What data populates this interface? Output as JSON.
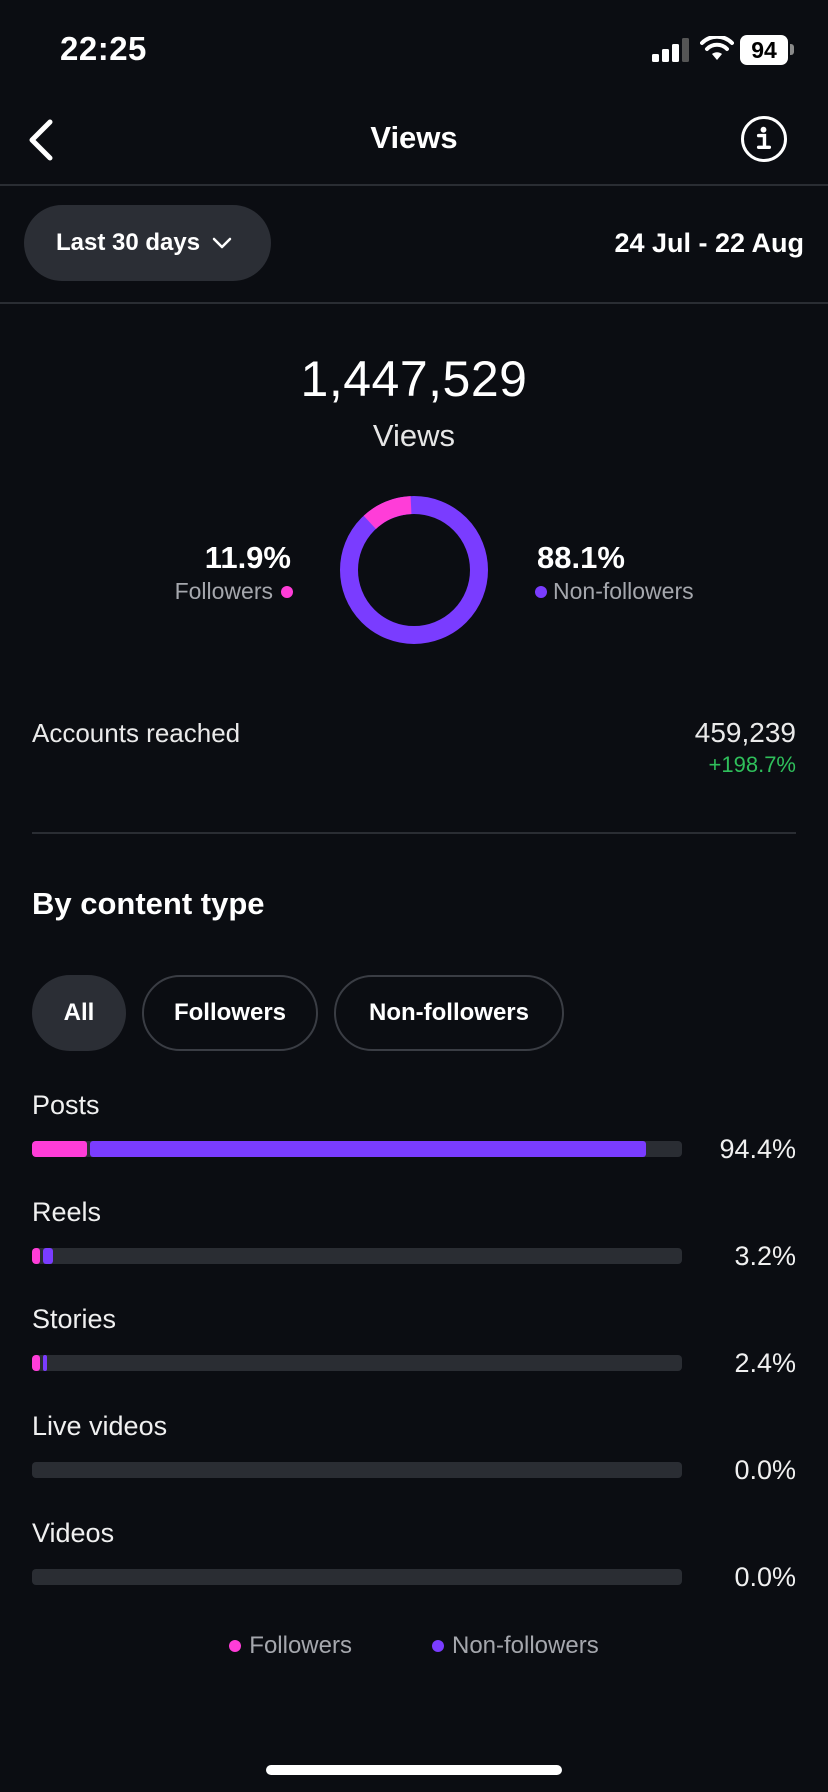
{
  "status_bar": {
    "time": "22:25",
    "battery": "94"
  },
  "header": {
    "title": "Views"
  },
  "range": {
    "label": "Last 30 days",
    "dates": "24 Jul - 22 Aug"
  },
  "summary": {
    "total": "1,447,529",
    "total_label": "Views",
    "followers_pct": "11.9%",
    "followers_label": "Followers",
    "nonfollowers_pct": "88.1%",
    "nonfollowers_label": "Non-followers",
    "followers_fraction": 0.119
  },
  "reach": {
    "label": "Accounts reached",
    "value": "459,239",
    "change": "+198.7%"
  },
  "content_type": {
    "title": "By content type",
    "filters": [
      "All",
      "Followers",
      "Non-followers"
    ],
    "active_filter": "All",
    "rows": [
      {
        "label": "Posts",
        "pct": "94.4%",
        "followers_fill": 0.085,
        "nonfollowers_fill": 0.855
      },
      {
        "label": "Reels",
        "pct": "3.2%",
        "followers_fill": 0.012,
        "nonfollowers_fill": 0.016
      },
      {
        "label": "Stories",
        "pct": "2.4%",
        "followers_fill": 0.012,
        "nonfollowers_fill": 0.007
      },
      {
        "label": "Live videos",
        "pct": "0.0%",
        "followers_fill": 0,
        "nonfollowers_fill": 0
      },
      {
        "label": "Videos",
        "pct": "0.0%",
        "followers_fill": 0,
        "nonfollowers_fill": 0
      }
    ],
    "legend": {
      "followers": "Followers",
      "nonfollowers": "Non-followers"
    }
  },
  "colors": {
    "followers": "#ff3dd8",
    "nonfollowers": "#7a3cff",
    "positive": "#2fbf5b"
  },
  "icons": {
    "back": "chevron-left-icon",
    "info": "info-icon",
    "dropdown": "chevron-down-icon"
  }
}
